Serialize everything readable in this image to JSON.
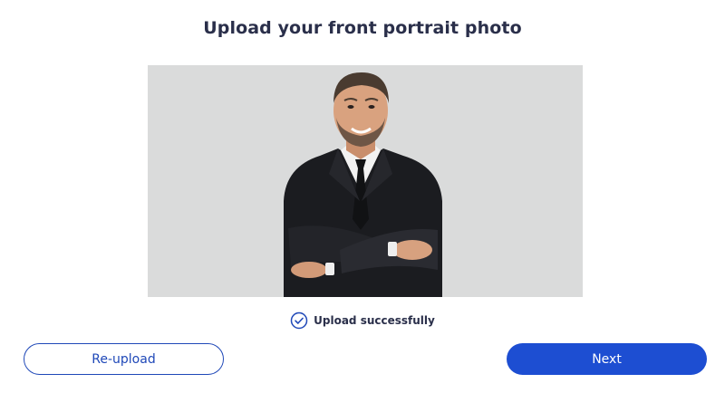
{
  "header": {
    "title": "Upload your front portrait photo"
  },
  "preview": {
    "image_subject": "portrait-photo",
    "background_color": "#dadbdb"
  },
  "status": {
    "icon": "check-circle-icon",
    "text": "Upload successfully"
  },
  "actions": {
    "reupload_label": "Re-upload",
    "next_label": "Next"
  },
  "colors": {
    "primary": "#1d4ed2",
    "text_dark": "#2a2f4a"
  }
}
